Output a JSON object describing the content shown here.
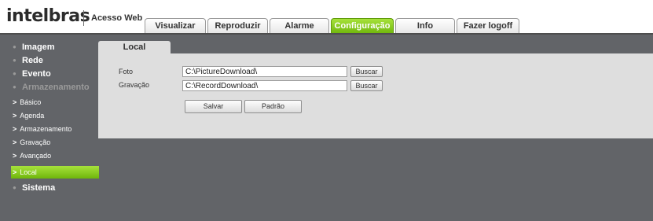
{
  "header": {
    "logo": "intelbras",
    "portal_label": "Acesso Web",
    "tabs": [
      {
        "label": "Visualizar"
      },
      {
        "label": "Reproduzir"
      },
      {
        "label": "Alarme"
      },
      {
        "label": "Configuração"
      },
      {
        "label": "Info"
      },
      {
        "label": "Fazer logoff"
      }
    ],
    "active_tab": "Configuração",
    "accent_color": "#7cc417"
  },
  "sidebar": {
    "items": [
      {
        "label": "Imagem"
      },
      {
        "label": "Rede"
      },
      {
        "label": "Evento"
      },
      {
        "label": "Armazenamento"
      },
      {
        "label": "Básico"
      },
      {
        "label": "Agenda"
      },
      {
        "label": "Armazenamento"
      },
      {
        "label": "Gravação"
      },
      {
        "label": "Avançado"
      },
      {
        "label": "Local"
      },
      {
        "label": "Sistema"
      }
    ],
    "sub_prefix": ">",
    "active_item": "Local"
  },
  "content": {
    "tab_label": "Local",
    "rows": [
      {
        "label": "Foto",
        "value": "C:\\PictureDownload\\",
        "button": "Buscar"
      },
      {
        "label": "Gravação",
        "value": "C:\\RecordDownload\\",
        "button": "Buscar"
      }
    ],
    "save_label": "Salvar",
    "default_label": "Padrão"
  }
}
